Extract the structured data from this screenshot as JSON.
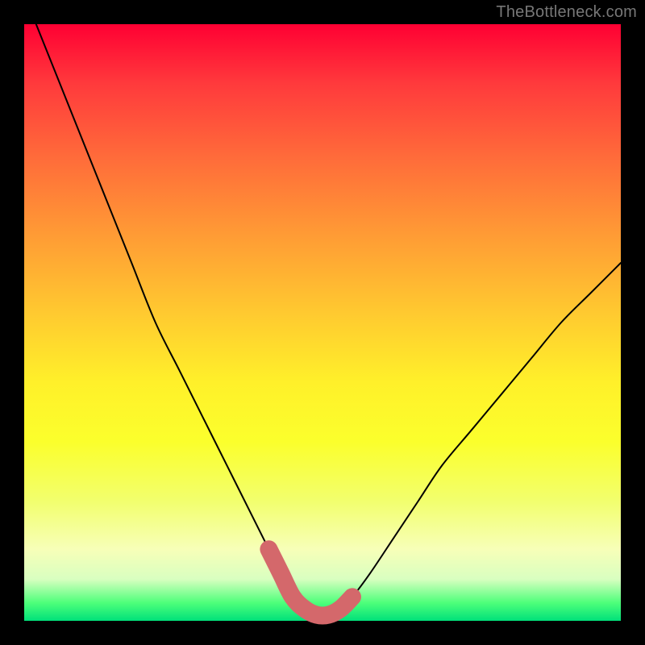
{
  "watermark": "TheBottleneck.com",
  "chart_data": {
    "type": "line",
    "title": "",
    "xlabel": "",
    "ylabel": "",
    "xlim": [
      0,
      100
    ],
    "ylim": [
      0,
      100
    ],
    "series": [
      {
        "name": "bottleneck-curve",
        "x": [
          2,
          6,
          10,
          14,
          18,
          22,
          26,
          30,
          34,
          38,
          41,
          43,
          45,
          47,
          49,
          51,
          53,
          55,
          58,
          62,
          66,
          70,
          75,
          80,
          85,
          90,
          95,
          100
        ],
        "y": [
          100,
          90,
          80,
          70,
          60,
          50,
          42,
          34,
          26,
          18,
          12,
          8,
          4,
          2,
          1,
          1,
          2,
          4,
          8,
          14,
          20,
          26,
          32,
          38,
          44,
          50,
          55,
          60
        ]
      }
    ],
    "highlight": {
      "name": "bottom-band",
      "color": "#d4686b",
      "x": [
        41,
        43,
        45,
        47,
        49,
        51,
        53,
        55
      ],
      "y": [
        12,
        8,
        4,
        2,
        1,
        1,
        2,
        4
      ]
    },
    "background": "rainbow-vertical-gradient"
  }
}
